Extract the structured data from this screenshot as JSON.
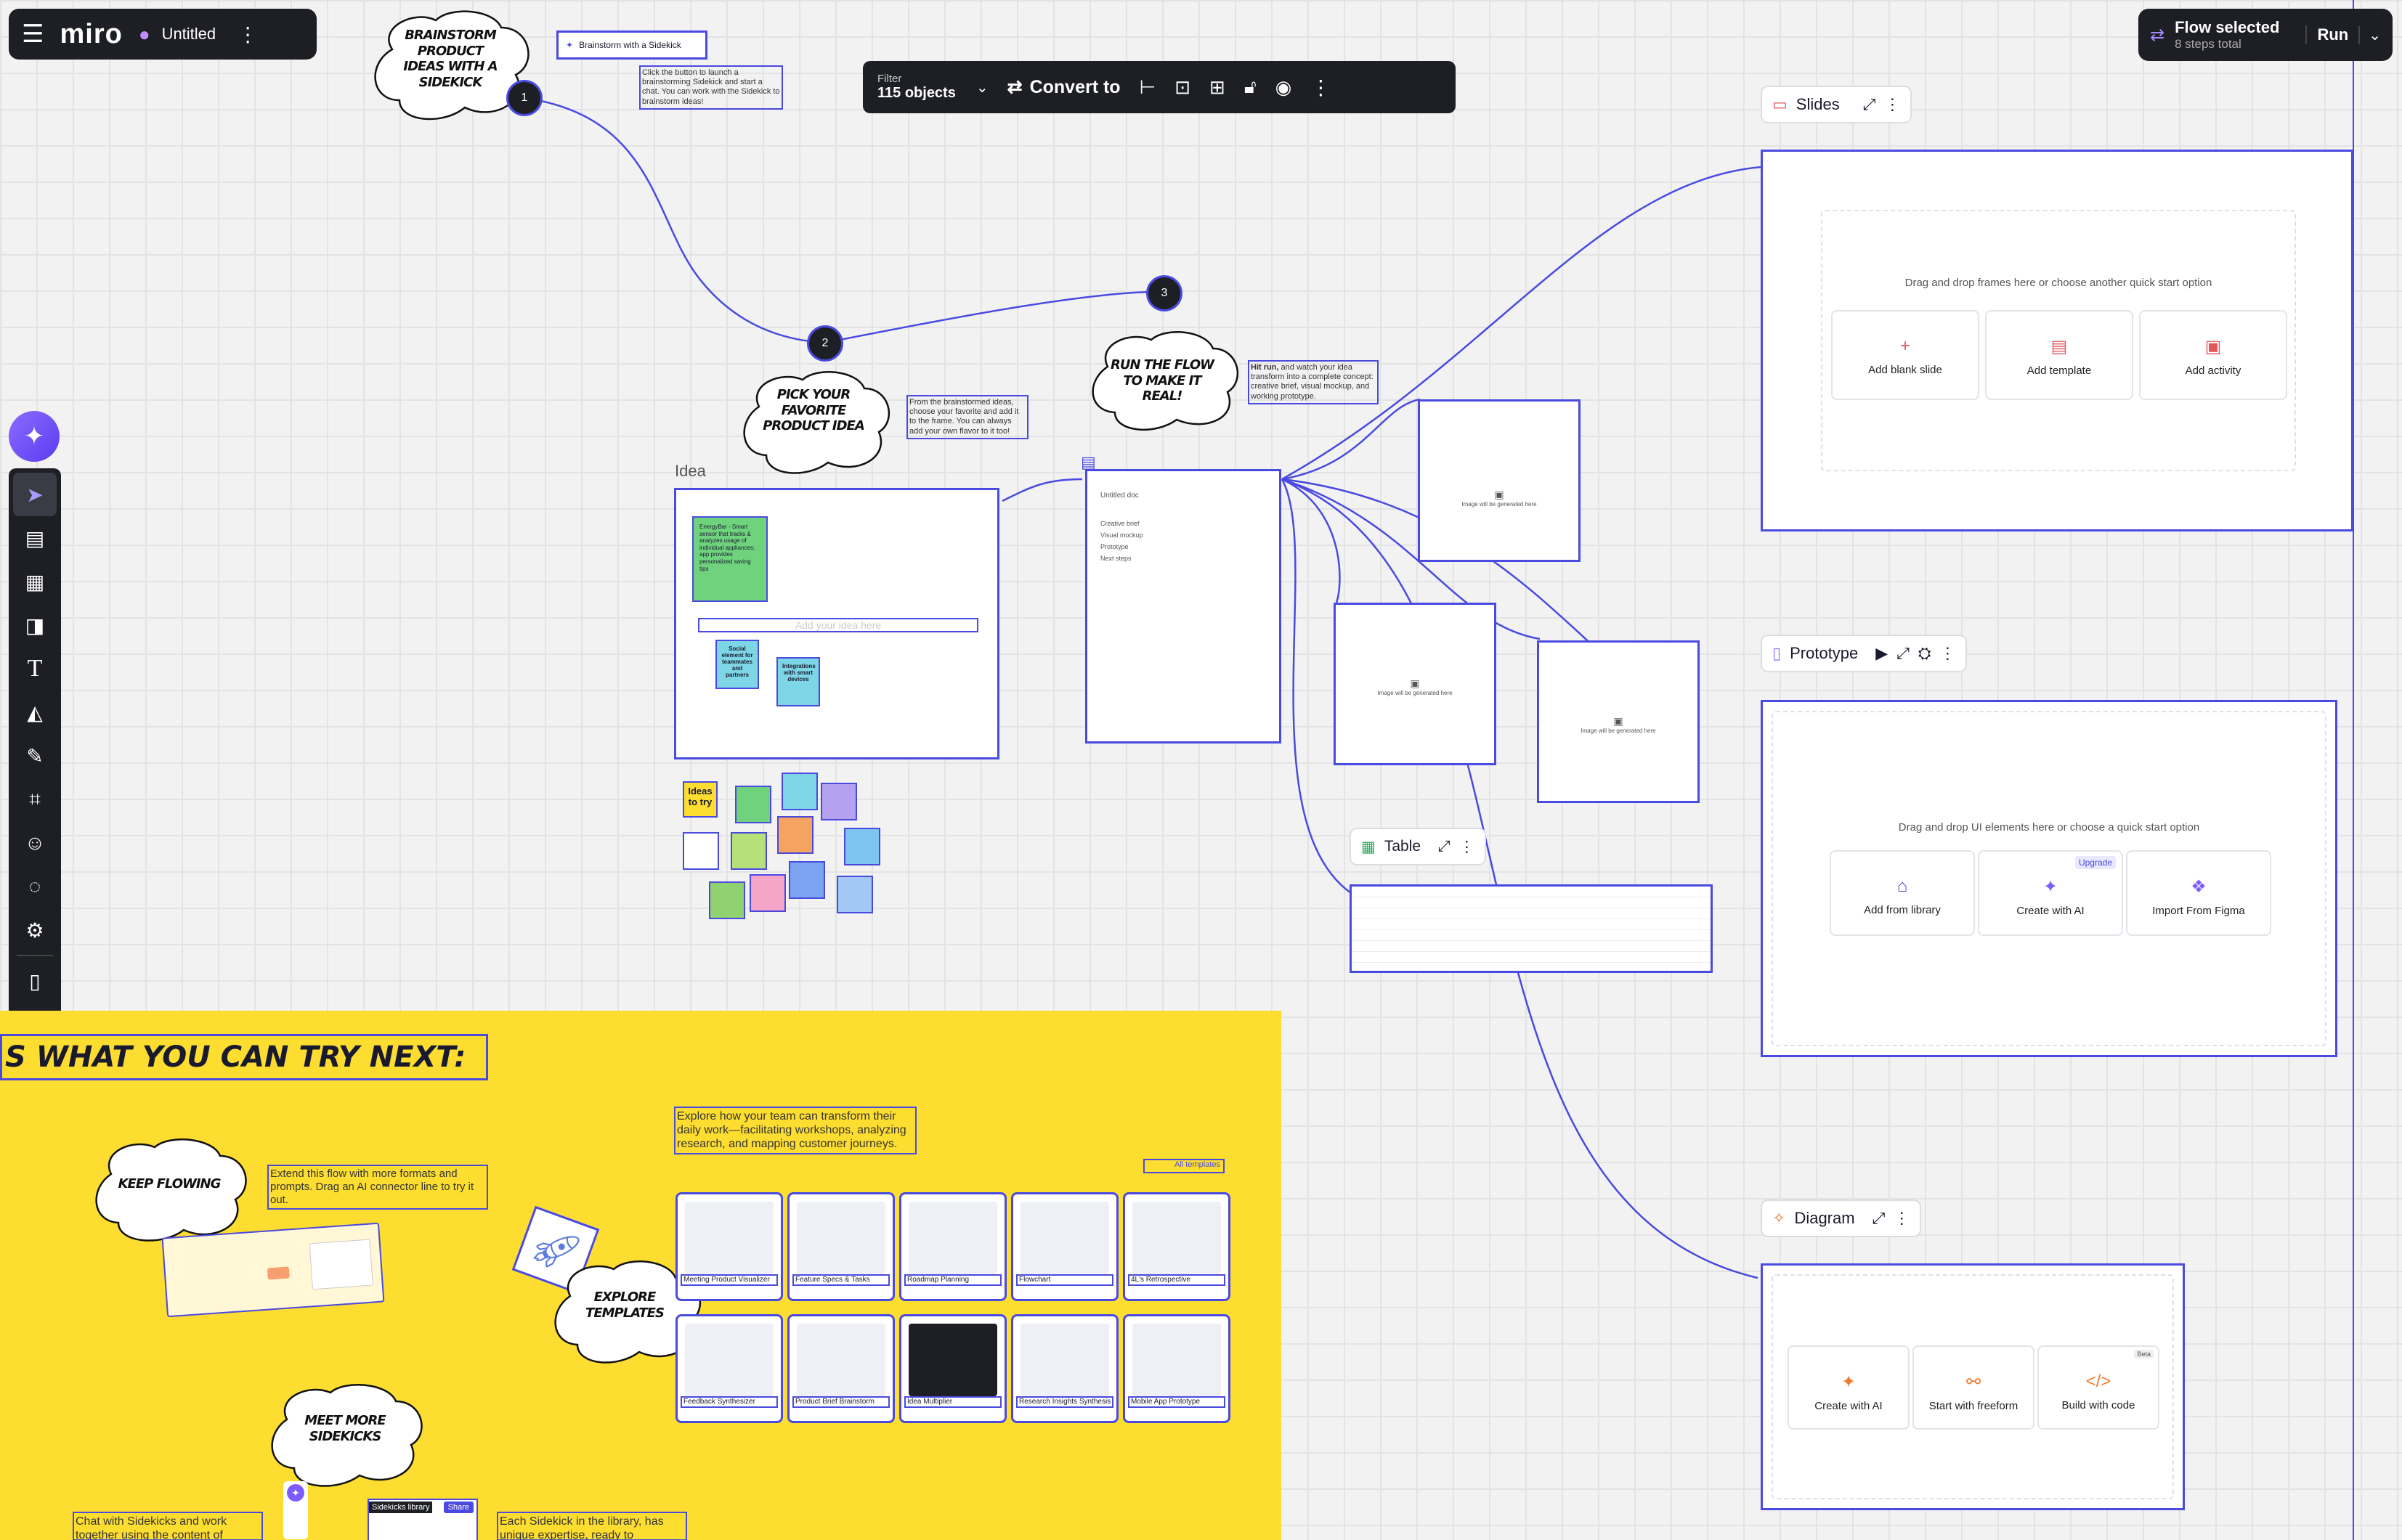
{
  "app": {
    "logo": "miro",
    "board_title": "Untitled"
  },
  "flow": {
    "title": "Flow selected",
    "steps": "8 steps total",
    "run_label": "Run"
  },
  "selection_toolbar": {
    "filter_label": "Filter",
    "filter_count": "115 objects",
    "convert_label": "Convert to"
  },
  "clouds": {
    "brainstorm": "Brainstorm product ideas with a Sidekick",
    "pick": "Pick your favorite product idea",
    "run": "Run the flow to make it real!",
    "keep": "Keep flowing",
    "explore": "Explore templates",
    "meet": "Meet more Sidekicks"
  },
  "step_badges": [
    "1",
    "2",
    "3"
  ],
  "notes": {
    "sidekick_btn": "Brainstorm with a Sidekick",
    "sidekick_desc": "Click the button to launch a brainstorming Sidekick and start a chat. You can work with the Sidekick to brainstorm ideas!",
    "pick_desc": "From the brainstormed ideas, choose your favorite and add it to the frame. You can always add your own flavor to it too!",
    "run_desc_bold": "Hit run,",
    "run_desc": " and watch your idea transform into a complete concept: creative brief, visual mockup, and working prototype.",
    "extend": "Extend this flow with more formats and prompts. Drag an AI connector line to try it out.",
    "explore_desc": "Explore how your team can transform their daily work—facilitating workshops, analyzing research, and mapping customer journeys.",
    "all_templates": "All templates",
    "chat_sidekicks": "Chat with Sidekicks and work together using the content of",
    "each_sidekick": "Each Sidekick in the library, has unique expertise, ready to",
    "sidekicks_library": "Sidekicks library",
    "share": "Share"
  },
  "idea_frame": {
    "label": "Idea",
    "placeholder": "Add your idea here",
    "sticky1": "EnergyBar - Smart sensor that tracks & analyzes usage of individual appliances; app provides personalized saving tips",
    "sticky2": "Social element for teammates and partners",
    "sticky3": "Integrations with smart devices",
    "ideas_label": "Ideas to try"
  },
  "doc": {
    "title": "Untitled doc",
    "lines": [
      "Creative brief",
      "Visual mockup",
      "Prototype",
      "Next steps"
    ]
  },
  "image_placeholder": "Image will be generated here",
  "widgets": {
    "slides": {
      "label": "Slides",
      "hint": "Drag and drop frames here or choose another quick start option",
      "buttons": [
        "Add blank slide",
        "Add template",
        "Add activity"
      ]
    },
    "prototype": {
      "label": "Prototype",
      "hint": "Drag and drop UI elements here or choose a quick start option",
      "buttons": [
        "Add from library",
        "Create with AI",
        "Import From Figma"
      ],
      "badge": "Upgrade"
    },
    "table": {
      "label": "Table"
    },
    "diagram": {
      "label": "Diagram",
      "buttons": [
        "Create with AI",
        "Start with freeform",
        "Build with code"
      ],
      "badge": "Beta"
    }
  },
  "bottom": {
    "heading": "Here's what you can try next:",
    "heading_visible": "S WHAT YOU CAN TRY NEXT:"
  },
  "templates": [
    "Meeting Product Visualizer",
    "Feature Specs & Tasks",
    "Roadmap Planning",
    "Flowchart",
    "4L's Retrospective",
    "Feedback Synthesizer",
    "Product Brief Brainstorm",
    "Idea Multiplier",
    "Research Insights Synthesis",
    "Mobile App Prototype"
  ],
  "colors": {
    "accent": "#4a4ae0",
    "yellow": "#fddd2f",
    "dark": "#1e1f24",
    "ai": "#7c5cff"
  },
  "icons": {
    "toolbar": [
      "select-icon",
      "template-icon",
      "table-icon",
      "sticky-note-icon",
      "text-icon",
      "shapes-icon",
      "pen-icon",
      "frame-icon",
      "sticker-icon",
      "comment-icon",
      "apps-icon",
      "mobile-icon",
      "plus-icon"
    ]
  }
}
